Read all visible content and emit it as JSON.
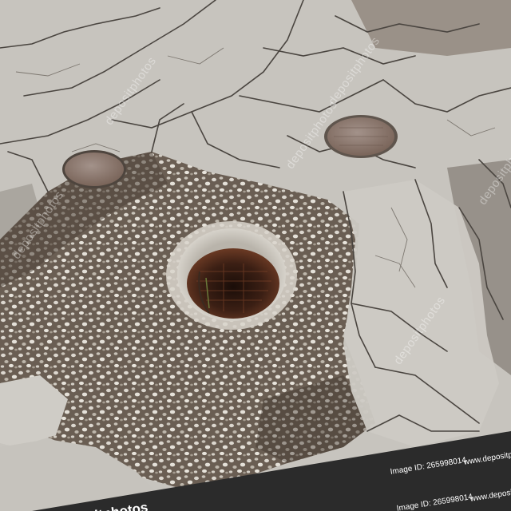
{
  "image": {
    "subject": "open-manhole-in-cracked-asphalt",
    "colors": {
      "asphalt_light": "#c9c6c0",
      "asphalt_mid": "#a8a49c",
      "gravel": "#d8d4cc",
      "dirt": "#5a4f45",
      "shaft": "#2a1a14",
      "rust": "#6b3a24",
      "manhole_cover": "#8a7466",
      "banner": "#2b2b2b"
    }
  },
  "watermark": {
    "text": "depositphotos"
  },
  "banner": {
    "image_id_top": "Image ID: 265998014",
    "site_top": "www.depositphoto",
    "image_id_bottom": "Image ID: 265998014",
    "site_bottom": "www.depositpho",
    "logo": "depositphotos"
  }
}
